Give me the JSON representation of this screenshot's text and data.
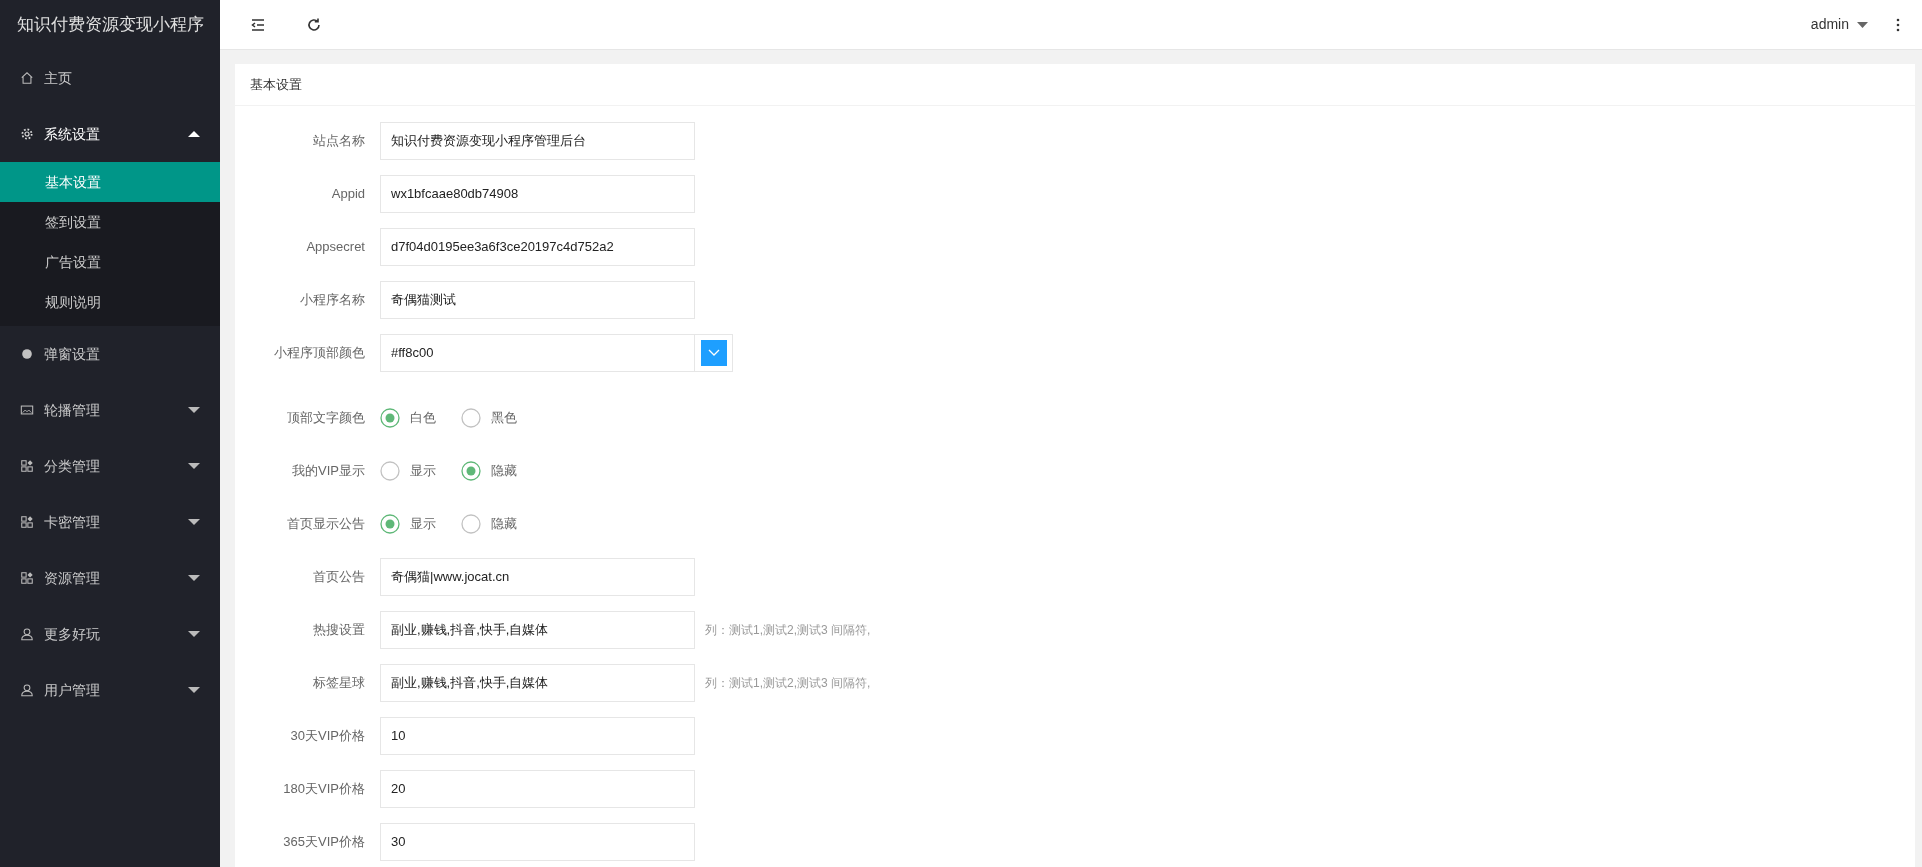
{
  "brand": "知识付费资源变现小程序",
  "header": {
    "user": "admin"
  },
  "sidebar": {
    "items": [
      {
        "kind": "link",
        "label": "主页"
      },
      {
        "kind": "group",
        "label": "系统设置",
        "expanded": true,
        "children": [
          {
            "label": "基本设置",
            "selected": true
          },
          {
            "label": "签到设置",
            "selected": false
          },
          {
            "label": "广告设置",
            "selected": false
          },
          {
            "label": "规则说明",
            "selected": false
          }
        ]
      },
      {
        "kind": "link",
        "label": "弹窗设置"
      },
      {
        "kind": "group",
        "label": "轮播管理",
        "expanded": false
      },
      {
        "kind": "group",
        "label": "分类管理",
        "expanded": false
      },
      {
        "kind": "group",
        "label": "卡密管理",
        "expanded": false
      },
      {
        "kind": "group",
        "label": "资源管理",
        "expanded": false
      },
      {
        "kind": "group",
        "label": "更多好玩",
        "expanded": false
      },
      {
        "kind": "group",
        "label": "用户管理",
        "expanded": false
      }
    ]
  },
  "card": {
    "title": "基本设置",
    "fields": [
      {
        "kind": "text",
        "label": "站点名称",
        "value": "知识付费资源变现小程序管理后台"
      },
      {
        "kind": "text",
        "label": "Appid",
        "value": "wx1bfcaae80db74908"
      },
      {
        "kind": "text",
        "label": "Appsecret",
        "value": "d7f04d0195ee3a6f3ce20197c4d752a2"
      },
      {
        "kind": "text",
        "label": "小程序名称",
        "value": "奇偶猫测试"
      },
      {
        "kind": "color",
        "label": "小程序顶部颜色",
        "value": "#ff8c00"
      },
      {
        "kind": "radio",
        "label": "顶部文字颜色",
        "options": [
          {
            "label": "白色",
            "selected": true
          },
          {
            "label": "黑色",
            "selected": false
          }
        ]
      },
      {
        "kind": "radio",
        "label": "我的VIP显示",
        "options": [
          {
            "label": "显示",
            "selected": false
          },
          {
            "label": "隐藏",
            "selected": true
          }
        ]
      },
      {
        "kind": "radio",
        "label": "首页显示公告",
        "options": [
          {
            "label": "显示",
            "selected": true
          },
          {
            "label": "隐藏",
            "selected": false
          }
        ]
      },
      {
        "kind": "text",
        "label": "首页公告",
        "value": "奇偶猫|www.jocat.cn"
      },
      {
        "kind": "text",
        "label": "热搜设置",
        "value": "副业,赚钱,抖音,快手,自媒体",
        "hint": "列：测试1,测试2,测试3 间隔符,"
      },
      {
        "kind": "text",
        "label": "标签星球",
        "value": "副业,赚钱,抖音,快手,自媒体",
        "hint": "列：测试1,测试2,测试3 间隔符,"
      },
      {
        "kind": "text",
        "label": "30天VIP价格",
        "value": "10"
      },
      {
        "kind": "text",
        "label": "180天VIP价格",
        "value": "20"
      },
      {
        "kind": "text",
        "label": "365天VIP价格",
        "value": "30"
      }
    ]
  }
}
